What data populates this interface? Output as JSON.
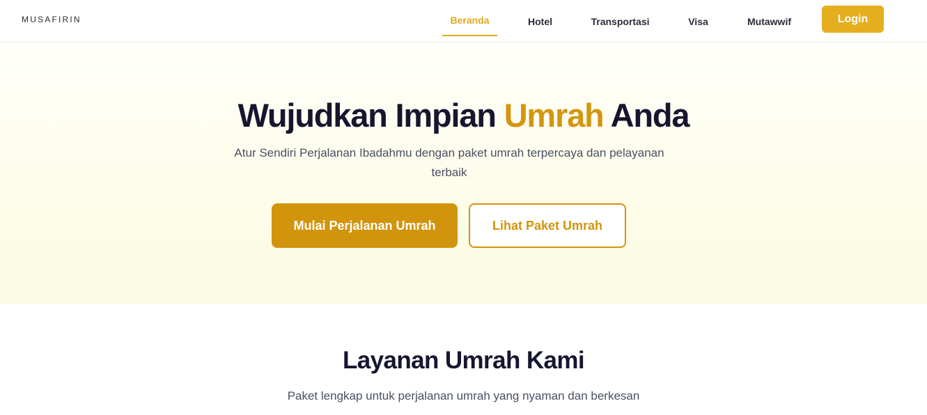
{
  "navbar": {
    "logo": "MUSAFIRIN",
    "links": [
      {
        "label": "Beranda",
        "active": true
      },
      {
        "label": "Hotel",
        "active": false
      },
      {
        "label": "Transportasi",
        "active": false
      },
      {
        "label": "Visa",
        "active": false
      },
      {
        "label": "Mutawwif",
        "active": false
      }
    ],
    "login_label": "Login"
  },
  "hero": {
    "title_part1": "Wujudkan Impian ",
    "title_accent": "Umrah",
    "title_part2": " Anda",
    "subtitle": "Atur Sendiri Perjalanan Ibadahmu dengan paket umrah terpercaya dan pelayanan terbaik",
    "primary_cta": "Mulai Perjalanan Umrah",
    "secondary_cta": "Lihat Paket Umrah"
  },
  "services": {
    "title": "Layanan Umrah Kami",
    "subtitle": "Paket lengkap untuk perjalanan umrah yang nyaman dan berkesan"
  },
  "colors": {
    "accent": "#e1a91c",
    "primary_button": "#d2940c",
    "heading": "#161630",
    "body_text": "#4a4f63"
  }
}
